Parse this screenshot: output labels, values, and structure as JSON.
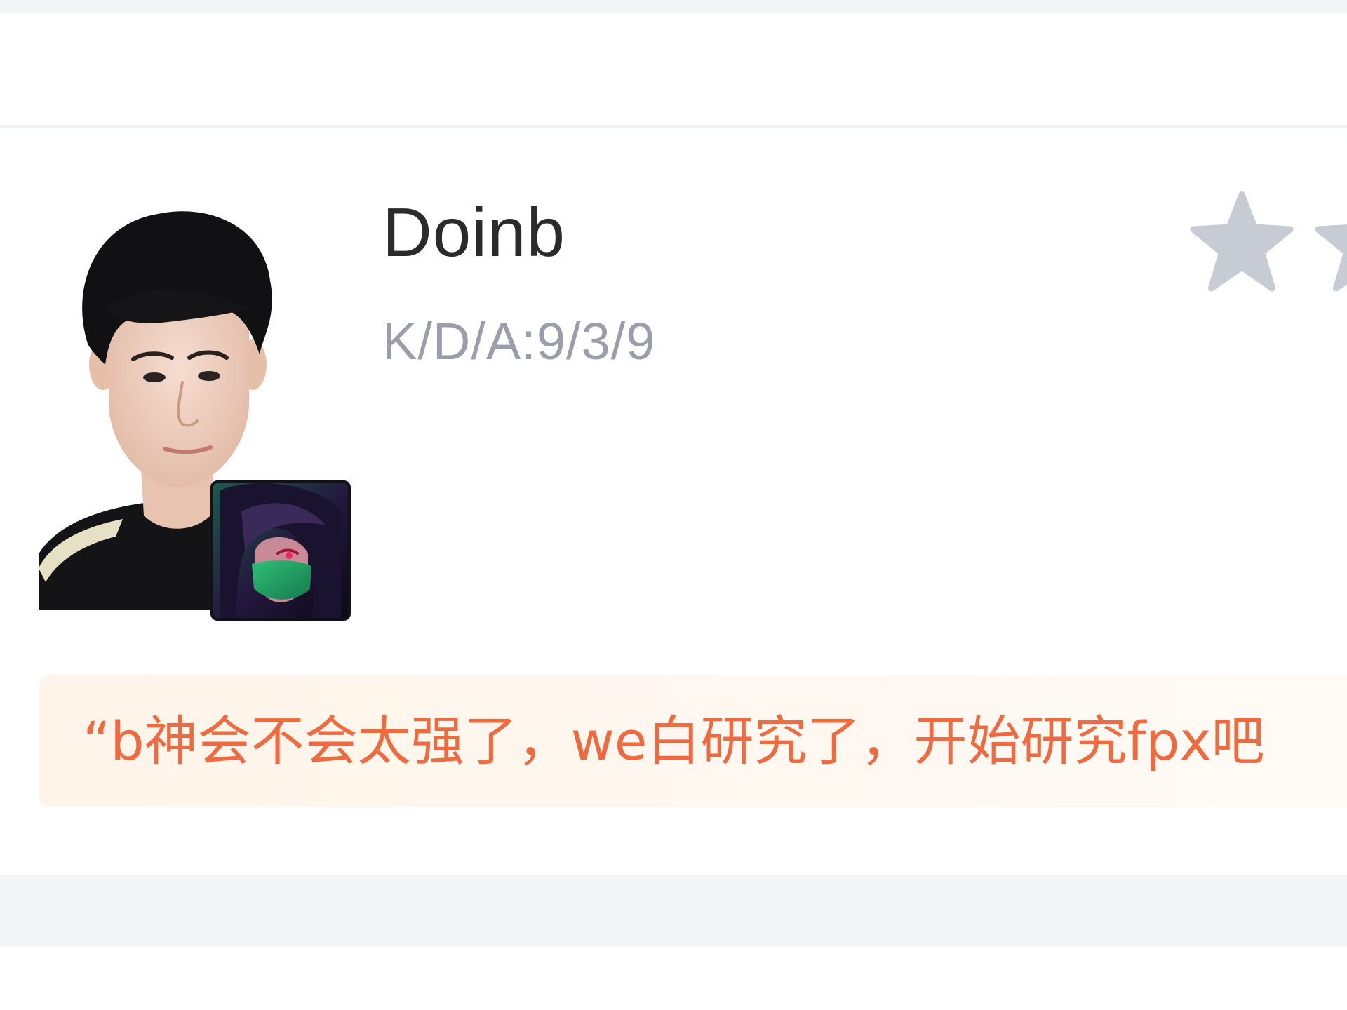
{
  "player": {
    "name": "Doinb",
    "kda": "K/D/A:9/3/9"
  },
  "rating": {
    "stars_shown": 2,
    "star_color": "#c7cbd4"
  },
  "comment": {
    "text": "“b神会不会太强了，we白研究了，开始研究fpx吧"
  },
  "colors": {
    "name": "#2b2b2b",
    "kda": "#9a9ea8",
    "comment_text": "#ef6a3f",
    "comment_bg": "#fff4e9",
    "page_band": "#f4f5f7"
  },
  "icons": {
    "player_photo": "player-avatar",
    "champion": "champion-icon",
    "rating": "star-icon"
  }
}
